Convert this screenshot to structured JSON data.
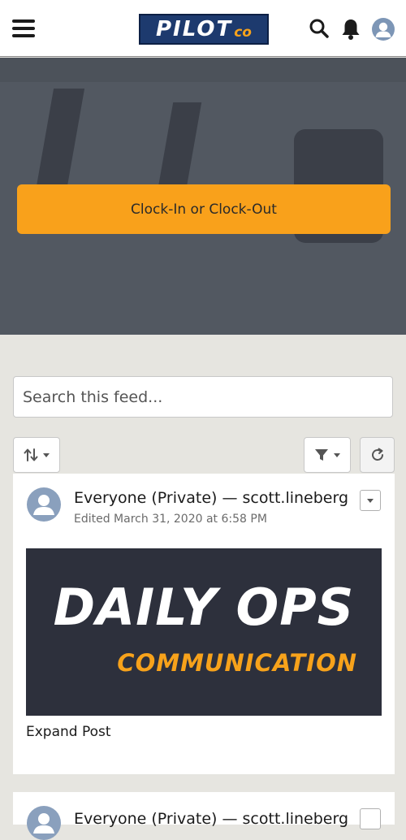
{
  "header": {
    "logo_main": "PILOT",
    "logo_co": "co",
    "menu_icon": "hamburger-menu-icon",
    "search_icon": "search-icon",
    "notifications_icon": "bell-icon",
    "profile_icon": "user-avatar-icon"
  },
  "hero": {
    "clock_button_label": "Clock-In or Clock-Out"
  },
  "feed": {
    "search_placeholder": "Search this feed...",
    "sort_icon": "sort-arrows-icon",
    "filter_icon": "filter-funnel-icon",
    "refresh_icon": "refresh-icon",
    "posts": [
      {
        "title": "Everyone (Private) — scott.lineberg",
        "meta": "Edited March 31, 2020 at 6:58 PM",
        "banner_title": "DAILY OPS",
        "banner_subtitle": "COMMUNICATION",
        "expand_label": "Expand Post"
      },
      {
        "title": "Everyone (Private) — scott.lineberg"
      }
    ]
  },
  "colors": {
    "accent": "#f9a11b",
    "logo_bg": "#1d3a6e",
    "hero_bg": "#525861",
    "page_bg": "#e6e5e0",
    "banner_bg": "#2d303c"
  }
}
